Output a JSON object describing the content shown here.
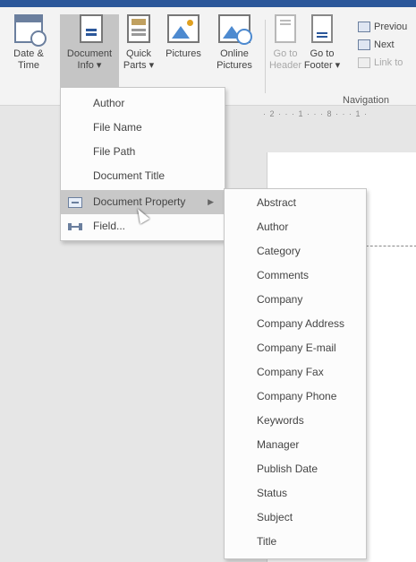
{
  "ribbon": {
    "buttons": [
      {
        "id": "date-time",
        "label_line1": "Date &",
        "label_line2": "Time",
        "icon": "calendar-clock-icon"
      },
      {
        "id": "document-info",
        "label_line1": "Document",
        "label_line2": "Info ▾",
        "icon": "document-info-icon"
      },
      {
        "id": "quick-parts",
        "label_line1": "Quick",
        "label_line2": "Parts ▾",
        "icon": "quick-parts-icon"
      },
      {
        "id": "pictures",
        "label_line1": "Pictures",
        "label_line2": "",
        "icon": "picture-icon"
      },
      {
        "id": "online-pictures",
        "label_line1": "Online",
        "label_line2": "Pictures",
        "icon": "online-picture-icon"
      },
      {
        "id": "go-to-header",
        "label_line1": "Go to",
        "label_line2": "Header",
        "icon": "header-icon"
      },
      {
        "id": "go-to-footer",
        "label_line1": "Go to",
        "label_line2": "Footer ▾",
        "icon": "footer-icon"
      }
    ],
    "navigation": {
      "previous": "Previou",
      "next": "Next",
      "link_to": "Link to",
      "group_label": "Navigation"
    }
  },
  "ruler": {
    "text": "· 2 · · · 1 · · · 8 · · · 1 ·"
  },
  "document_info_menu": {
    "items": [
      "Author",
      "File Name",
      "File Path",
      "Document Title"
    ],
    "document_property": "Document Property",
    "field": "Field..."
  },
  "document_property_submenu": {
    "items": [
      "Abstract",
      "Author",
      "Category",
      "Comments",
      "Company",
      "Company Address",
      "Company E-mail",
      "Company Fax",
      "Company Phone",
      "Keywords",
      "Manager",
      "Publish Date",
      "Status",
      "Subject",
      "Title"
    ]
  }
}
